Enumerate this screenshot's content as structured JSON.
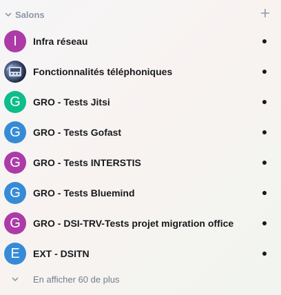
{
  "section": {
    "title": "Salons",
    "chevron_icon": "chevron-down-icon",
    "add_icon": "plus-icon"
  },
  "colors": {
    "purple": "#ac3ba8",
    "green": "#0dbd8b",
    "blue": "#368bd6",
    "text": "#17191c",
    "muted": "#737d8c"
  },
  "rooms": [
    {
      "name": "Infra réseau",
      "initial": "I",
      "color": "#ac3ba8",
      "avatar_type": "letter",
      "unread": true
    },
    {
      "name": "Fonctionnalités téléphoniques",
      "initial": "",
      "color": "",
      "avatar_type": "image",
      "unread": true
    },
    {
      "name": "GRO - Tests Jitsi",
      "initial": "G",
      "color": "#0dbd8b",
      "avatar_type": "letter",
      "unread": true
    },
    {
      "name": "GRO - Tests Gofast",
      "initial": "G",
      "color": "#368bd6",
      "avatar_type": "letter",
      "unread": true
    },
    {
      "name": "GRO - Tests INTERSTIS",
      "initial": "G",
      "color": "#ac3ba8",
      "avatar_type": "letter",
      "unread": true
    },
    {
      "name": "GRO - Tests Bluemind",
      "initial": "G",
      "color": "#368bd6",
      "avatar_type": "letter",
      "unread": true
    },
    {
      "name": "GRO - DSI-TRV-Tests projet migration office",
      "initial": "G",
      "color": "#ac3ba8",
      "avatar_type": "letter",
      "unread": true
    },
    {
      "name": "EXT - DSITN",
      "initial": "E",
      "color": "#368bd6",
      "avatar_type": "letter",
      "unread": true
    }
  ],
  "show_more": {
    "label": "En afficher 60 de plus"
  }
}
